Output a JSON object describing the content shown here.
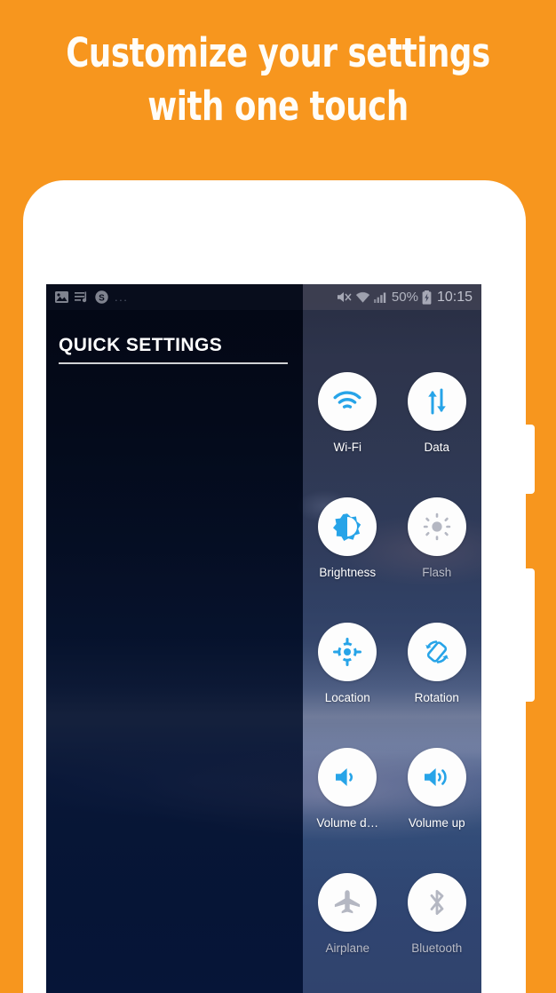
{
  "promo": {
    "headline": "Customize your settings with one touch",
    "background_color": "#f7961e",
    "headline_color": "#fffdf8"
  },
  "phone": {
    "body_color": "#ffffff",
    "side_buttons": [
      {
        "name": "volume-rocker"
      },
      {
        "name": "power-button"
      }
    ]
  },
  "status_bar": {
    "left_icons": [
      "image-icon",
      "playlist-icon",
      "skype-icon"
    ],
    "overflow": "...",
    "right_icons": [
      "mute-icon",
      "wifi-icon",
      "signal-bars-icon",
      "battery-charging-icon"
    ],
    "battery_percent": "50%",
    "clock": "10:15"
  },
  "panel": {
    "title": "QUICK SETTINGS",
    "accent_color": "#27a4e8",
    "tile_bg_color": "#fdfdfd",
    "inactive_color": "#b4b7c2"
  },
  "tiles": [
    {
      "label": "Wi-Fi",
      "icon": "wifi-icon",
      "active": true
    },
    {
      "label": "Data",
      "icon": "data-icon",
      "active": true
    },
    {
      "label": "Brightness",
      "icon": "brightness-icon",
      "active": true
    },
    {
      "label": "Flash",
      "icon": "flash-icon",
      "active": false
    },
    {
      "label": "Location",
      "icon": "location-icon",
      "active": true
    },
    {
      "label": "Rotation",
      "icon": "rotation-icon",
      "active": true
    },
    {
      "label": "Volume d…",
      "icon": "volume-down-icon",
      "active": true
    },
    {
      "label": "Volume up",
      "icon": "volume-up-icon",
      "active": true
    },
    {
      "label": "Airplane",
      "icon": "airplane-icon",
      "active": false
    },
    {
      "label": "Bluetooth",
      "icon": "bluetooth-icon",
      "active": false
    }
  ]
}
